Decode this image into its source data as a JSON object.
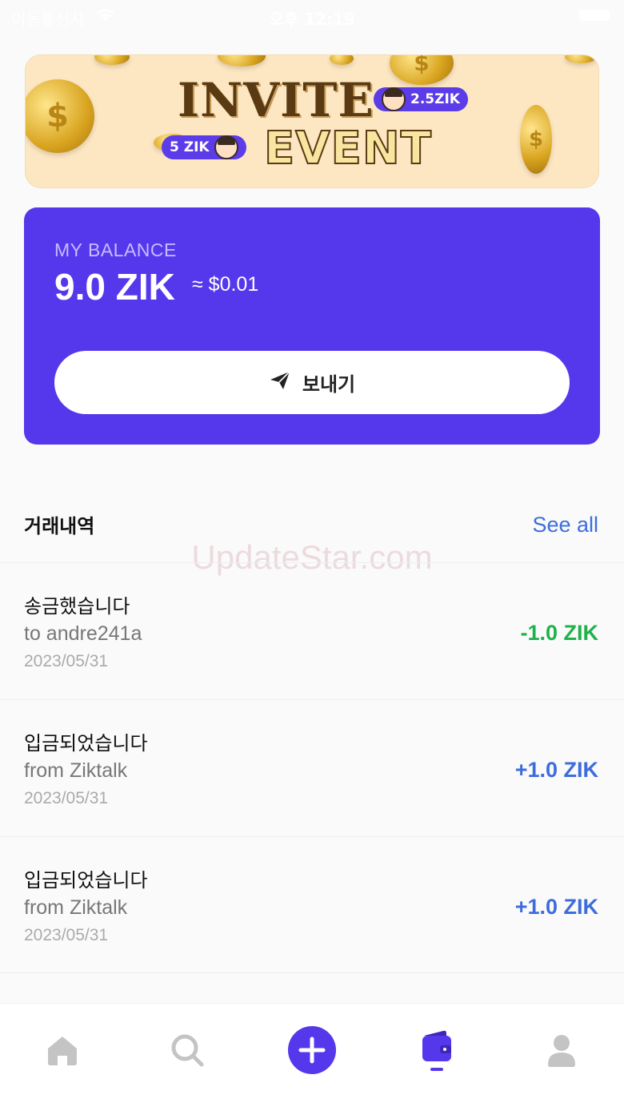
{
  "status_bar": {
    "carrier": "이동통신사",
    "time": "오후 12:19"
  },
  "banner": {
    "title_line1": "INVITE",
    "title_line2": "EVENT",
    "bubble_left": "5 ZIK",
    "bubble_right": "2.5ZIK"
  },
  "balance": {
    "label": "MY BALANCE",
    "amount": "9.0 ZIK",
    "usd": "≈ $0.01",
    "send_label": "보내기"
  },
  "transactions": {
    "title": "거래내역",
    "see_all": "See all",
    "items": [
      {
        "title": "송금했습니다",
        "party": "to andre241a",
        "date": "2023/05/31",
        "amount": "-1.0 ZIK",
        "color": "#1fb24a"
      },
      {
        "title": "입금되었습니다",
        "party": "from Ziktalk",
        "date": "2023/05/31",
        "amount": "+1.0 ZIK",
        "color": "#3d6ddc"
      },
      {
        "title": "입금되었습니다",
        "party": "from Ziktalk",
        "date": "2023/05/31",
        "amount": "+1.0 ZIK",
        "color": "#3d6ddc"
      }
    ]
  },
  "watermark": "UpdateStar.com",
  "tabbar": {
    "items": [
      {
        "icon": "home-icon",
        "active": false
      },
      {
        "icon": "search-icon",
        "active": false
      },
      {
        "icon": "plus-icon",
        "active": false
      },
      {
        "icon": "wallet-icon",
        "active": true
      },
      {
        "icon": "profile-icon",
        "active": false
      }
    ]
  },
  "colors": {
    "accent": "#5538ec",
    "positive": "#3d6ddc",
    "negative": "#1fb24a",
    "inactive_icon": "#c4c4c4"
  }
}
